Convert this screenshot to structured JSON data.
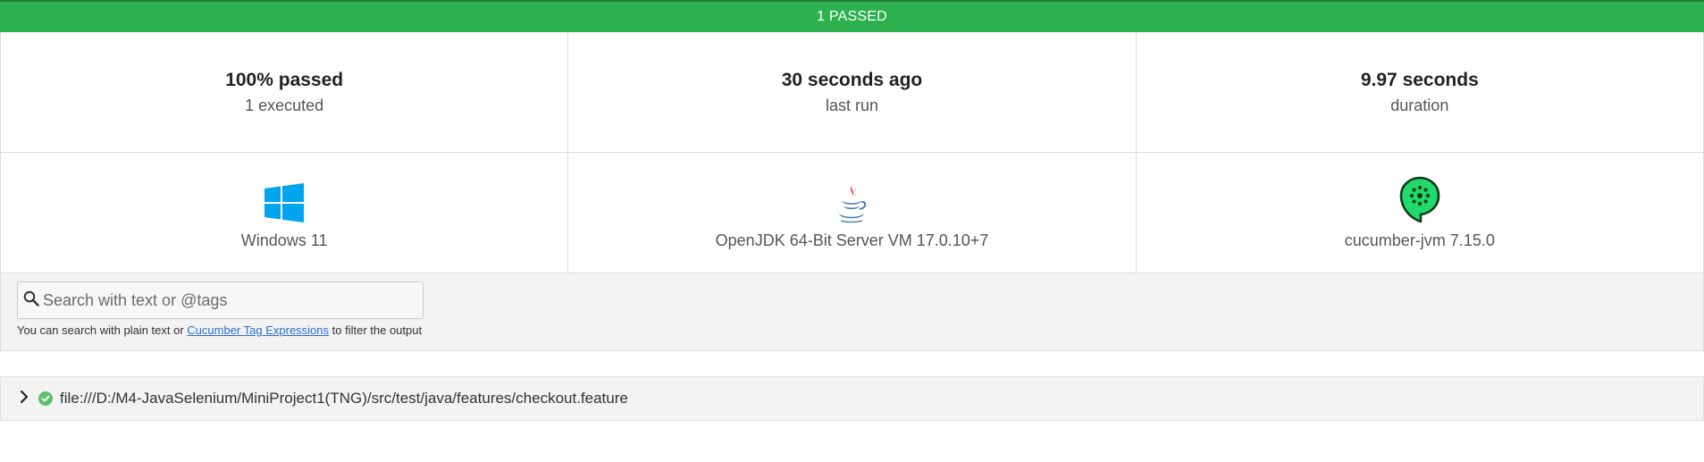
{
  "banner": {
    "text": "1 PASSED",
    "color": "#2db14f"
  },
  "stats": [
    {
      "main": "100% passed",
      "sub": "1 executed"
    },
    {
      "main": "30 seconds ago",
      "sub": "last run"
    },
    {
      "main": "9.97 seconds",
      "sub": "duration"
    }
  ],
  "env": [
    {
      "icon": "windows-logo-icon",
      "label": "Windows 11"
    },
    {
      "icon": "java-logo-icon",
      "label": "OpenJDK 64-Bit Server VM 17.0.10+7"
    },
    {
      "icon": "cucumber-logo-icon",
      "label": "cucumber-jvm 7.15.0"
    }
  ],
  "search": {
    "placeholder": "Search with text or @tags",
    "help_before": "You can search with plain text or ",
    "help_link": "Cucumber Tag Expressions",
    "help_after": " to filter the output"
  },
  "features": [
    {
      "status": "passed",
      "path": "file:///D:/M4-JavaSelenium/MiniProject1(TNG)/src/test/java/features/checkout.feature"
    }
  ],
  "colors": {
    "passed": "#2db14f",
    "link": "#2c6fd1",
    "windows": "#00a4ef",
    "cucumber": "#23d96c"
  }
}
